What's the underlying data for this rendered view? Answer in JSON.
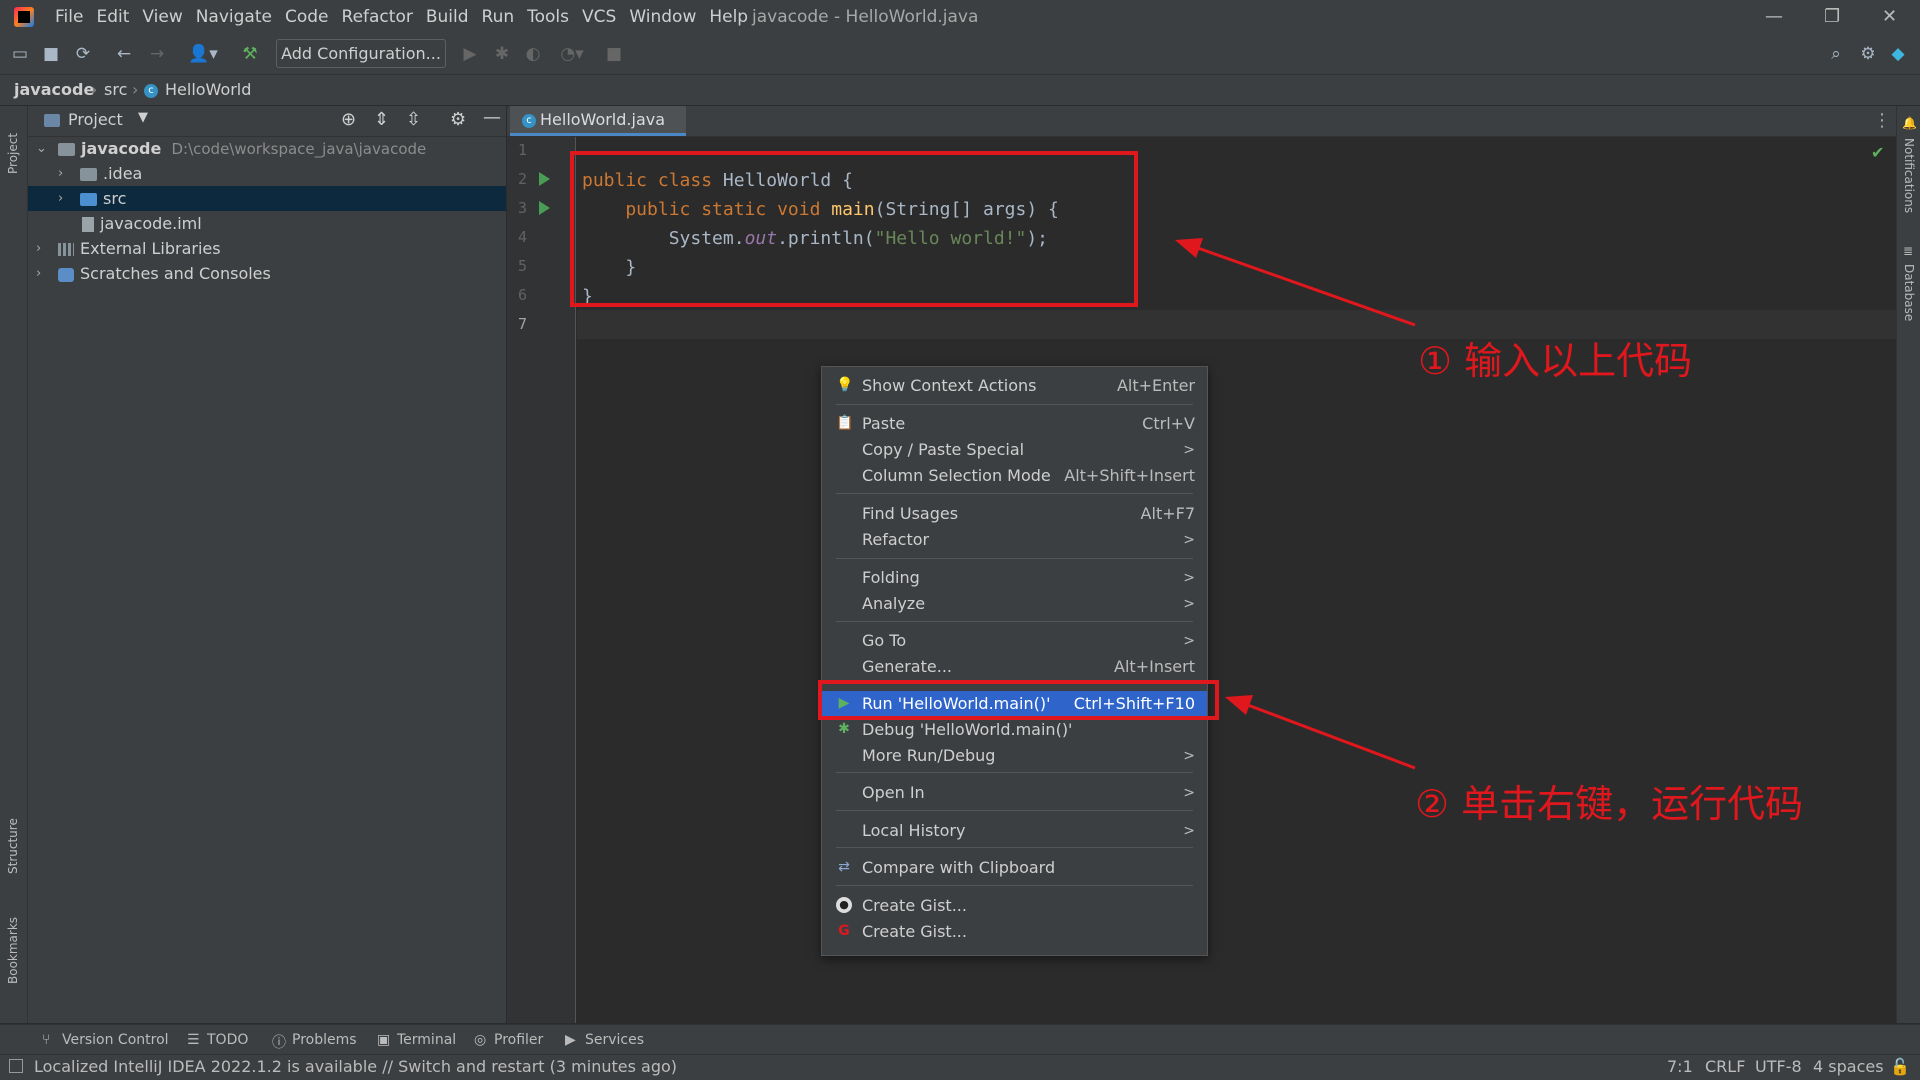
{
  "app": {
    "menu": [
      "File",
      "Edit",
      "View",
      "Navigate",
      "Code",
      "Refactor",
      "Build",
      "Run",
      "Tools",
      "VCS",
      "Window",
      "Help"
    ],
    "window_title": "javacode - HelloWorld.java"
  },
  "toolbar": {
    "add_configuration": "Add Configuration..."
  },
  "breadcrumb": {
    "project": "javacode",
    "folder": "src",
    "file": "HelloWorld"
  },
  "left_stripe": {
    "project": "Project",
    "structure": "Structure",
    "bookmarks": "Bookmarks"
  },
  "right_stripe": {
    "notifications": "Notifications",
    "database": "Database"
  },
  "project_panel": {
    "title": "Project",
    "root": {
      "name": "javacode",
      "path": "D:\\code\\workspace_java\\javacode"
    },
    "items": [
      {
        "name": ".idea"
      },
      {
        "name": "src"
      },
      {
        "name": "javacode.iml"
      },
      {
        "name": "External Libraries"
      },
      {
        "name": "Scratches and Consoles"
      }
    ]
  },
  "editor": {
    "tab": "HelloWorld.java",
    "line_numbers": [
      "1",
      "2",
      "3",
      "4",
      "5",
      "6",
      "7"
    ],
    "code": {
      "l2_a": "public class ",
      "l2_b": "HelloWorld {",
      "l3_a": "    public static void ",
      "l3_fn": "main",
      "l3_b": "(String[] args) {",
      "l4_a": "        System.",
      "l4_out": "out",
      "l4_b": ".println(",
      "l4_str": "\"Hello world!\"",
      "l4_c": ");",
      "l5": "    }",
      "l6": "}"
    }
  },
  "context_menu": {
    "items": [
      {
        "label": "Show Context Actions",
        "shortcut": "Alt+Enter"
      },
      {
        "label": "Paste",
        "shortcut": "Ctrl+V"
      },
      {
        "label": "Copy / Paste Special",
        "shortcut": ">"
      },
      {
        "label": "Column Selection Mode",
        "shortcut": "Alt+Shift+Insert"
      },
      {
        "label": "Find Usages",
        "shortcut": "Alt+F7"
      },
      {
        "label": "Refactor",
        "shortcut": ">"
      },
      {
        "label": "Folding",
        "shortcut": ">"
      },
      {
        "label": "Analyze",
        "shortcut": ">"
      },
      {
        "label": "Go To",
        "shortcut": ">"
      },
      {
        "label": "Generate...",
        "shortcut": "Alt+Insert"
      },
      {
        "label": "Run 'HelloWorld.main()'",
        "shortcut": "Ctrl+Shift+F10"
      },
      {
        "label": "Debug 'HelloWorld.main()'",
        "shortcut": ""
      },
      {
        "label": "More Run/Debug",
        "shortcut": ">"
      },
      {
        "label": "Open In",
        "shortcut": ">"
      },
      {
        "label": "Local History",
        "shortcut": ">"
      },
      {
        "label": "Compare with Clipboard",
        "shortcut": ""
      },
      {
        "label": "Create Gist...",
        "shortcut": ""
      },
      {
        "label": "Create Gist...",
        "shortcut": ""
      }
    ]
  },
  "annotations": {
    "step1": "① 输入以上代码",
    "step2": "② 单击右键，运行代码"
  },
  "bottom_tools": [
    "Version Control",
    "TODO",
    "Problems",
    "Terminal",
    "Profiler",
    "Services"
  ],
  "status_bar": {
    "message": "Localized IntelliJ IDEA 2022.1.2 is available // Switch and restart (3 minutes ago)",
    "position": "7:1",
    "line_sep": "CRLF",
    "encoding": "UTF-8",
    "indent": "4 spaces"
  },
  "colors": {
    "accent": "#2f65ca",
    "annotation_red": "#e0171c",
    "run_green": "#499c54"
  }
}
